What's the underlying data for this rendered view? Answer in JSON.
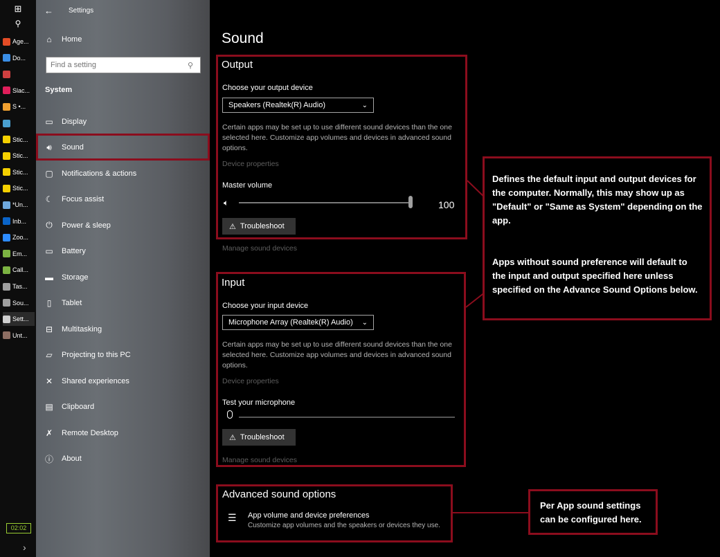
{
  "taskbar": {
    "items": [
      {
        "label": "Age...",
        "color": "#e34c26"
      },
      {
        "label": "Do...",
        "color": "#3a8ee6"
      },
      {
        "label": "",
        "color": "#d04040"
      },
      {
        "label": "Slac...",
        "color": "#e01e5a"
      },
      {
        "label": "S •...",
        "color": "#f0a030"
      },
      {
        "label": "",
        "color": "#4aa0d0"
      },
      {
        "label": "Stic...",
        "color": "#f5d000"
      },
      {
        "label": "Stic...",
        "color": "#f5d000"
      },
      {
        "label": "Stic...",
        "color": "#f5d000"
      },
      {
        "label": "Stic...",
        "color": "#f5d000"
      },
      {
        "label": "*Un...",
        "color": "#6fa8dc"
      },
      {
        "label": "Inb...",
        "color": "#0a64c8"
      },
      {
        "label": "Zoo...",
        "color": "#2d8cff"
      },
      {
        "label": "Em...",
        "color": "#7cb342"
      },
      {
        "label": "Call...",
        "color": "#7cb342"
      },
      {
        "label": "Tas...",
        "color": "#9e9e9e"
      },
      {
        "label": "Sou...",
        "color": "#9e9e9e"
      },
      {
        "label": "Sett...",
        "color": "#cfcfcf"
      },
      {
        "label": "Unt...",
        "color": "#8d6e63"
      }
    ],
    "clock": "02:02"
  },
  "window": {
    "title": "Settings"
  },
  "sidebar": {
    "home": "Home",
    "search_placeholder": "Find a setting",
    "section": "System",
    "items": [
      {
        "label": "Display",
        "icon": "monitor-icon"
      },
      {
        "label": "Sound",
        "icon": "speaker-icon"
      },
      {
        "label": "Notifications & actions",
        "icon": "notification-icon"
      },
      {
        "label": "Focus assist",
        "icon": "moon-icon"
      },
      {
        "label": "Power & sleep",
        "icon": "power-icon"
      },
      {
        "label": "Battery",
        "icon": "battery-icon"
      },
      {
        "label": "Storage",
        "icon": "storage-icon"
      },
      {
        "label": "Tablet",
        "icon": "tablet-icon"
      },
      {
        "label": "Multitasking",
        "icon": "multitasking-icon"
      },
      {
        "label": "Projecting to this PC",
        "icon": "projector-icon"
      },
      {
        "label": "Shared experiences",
        "icon": "shared-icon"
      },
      {
        "label": "Clipboard",
        "icon": "clipboard-icon"
      },
      {
        "label": "Remote Desktop",
        "icon": "remote-icon"
      },
      {
        "label": "About",
        "icon": "info-icon"
      }
    ],
    "selected": "Sound"
  },
  "main": {
    "title": "Sound",
    "output": {
      "title": "Output",
      "choose_label": "Choose your output device",
      "device": "Speakers (Realtek(R) Audio)",
      "description": "Certain apps may be set up to use different sound devices than the one selected here. Customize app volumes and devices in advanced sound options.",
      "device_properties": "Device properties",
      "volume_label": "Master volume",
      "volume_value": "100",
      "troubleshoot": "Troubleshoot",
      "manage": "Manage sound devices"
    },
    "input": {
      "title": "Input",
      "choose_label": "Choose your input device",
      "device": "Microphone Array (Realtek(R) Audio)",
      "description": "Certain apps may be set up to use different sound devices than the one selected here. Customize app volumes and devices in advanced sound options.",
      "device_properties": "Device properties",
      "test_label": "Test your microphone",
      "troubleshoot": "Troubleshoot",
      "manage": "Manage sound devices"
    },
    "advanced": {
      "title": "Advanced sound options",
      "item_title": "App volume and device preferences",
      "item_desc": "Customize app volumes and the speakers or devices they use."
    }
  },
  "annotations": {
    "callout1_p1": "Defines the default input and output devices for the computer. Normally, this may show up as \"Default\" or \"Same as System\" depending on the app.",
    "callout1_p2": "Apps without sound preference will default to the input and output specified here unless specified on the Advance Sound Options below.",
    "callout2": "Per App sound settings can be configured here.",
    "accent_color": "#8b0d1d"
  }
}
